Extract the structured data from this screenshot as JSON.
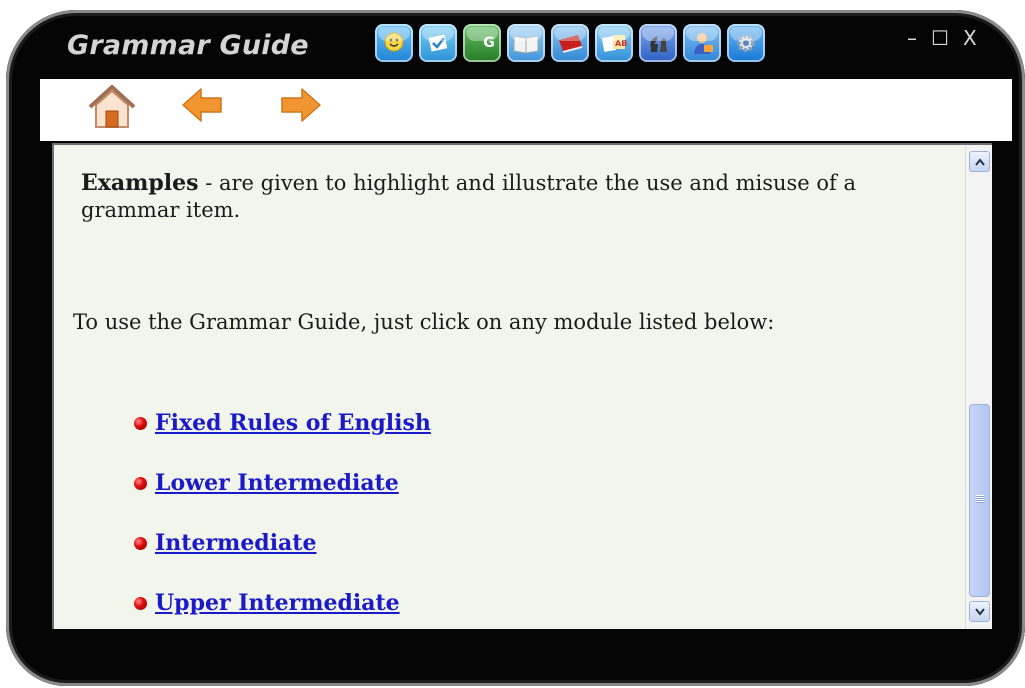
{
  "window": {
    "title": "Grammar Guide",
    "controls": {
      "minimize": "–",
      "maximize": "☐",
      "close": "X"
    }
  },
  "app_icons": [
    {
      "name": "chat-smiley-icon",
      "color": "#3da1e8"
    },
    {
      "name": "checkmark-icon",
      "color": "#2b9fe0"
    },
    {
      "name": "grammar-g-icon",
      "color": "#3aa23a",
      "label": "G"
    },
    {
      "name": "open-book-icon",
      "color": "#5aa8e8"
    },
    {
      "name": "red-book-icon",
      "color": "#cc2a2a"
    },
    {
      "name": "abc-cards-icon",
      "color": "#3f9fe2"
    },
    {
      "name": "chess-icon",
      "color": "#3c6fd6"
    },
    {
      "name": "teacher-icon",
      "color": "#3b8fe0"
    },
    {
      "name": "settings-gear-icon",
      "color": "#1f82e0"
    }
  ],
  "toolbar": {
    "home": "home-icon",
    "back": "back-arrow-icon",
    "forward": "forward-arrow-icon"
  },
  "content": {
    "examples_term": "Examples",
    "examples_text": " - are given to highlight and illustrate the use and misuse of a grammar item.",
    "instruction": "To use the Grammar Guide, just click on any module listed below:",
    "modules": [
      "Fixed Rules of English",
      "Lower Intermediate",
      "Intermediate",
      "Upper Intermediate"
    ]
  },
  "colors": {
    "frame": "#050505",
    "pane_bg": "#f1f5ec",
    "link": "#1a1ac9",
    "arrow": "#f0982e"
  }
}
